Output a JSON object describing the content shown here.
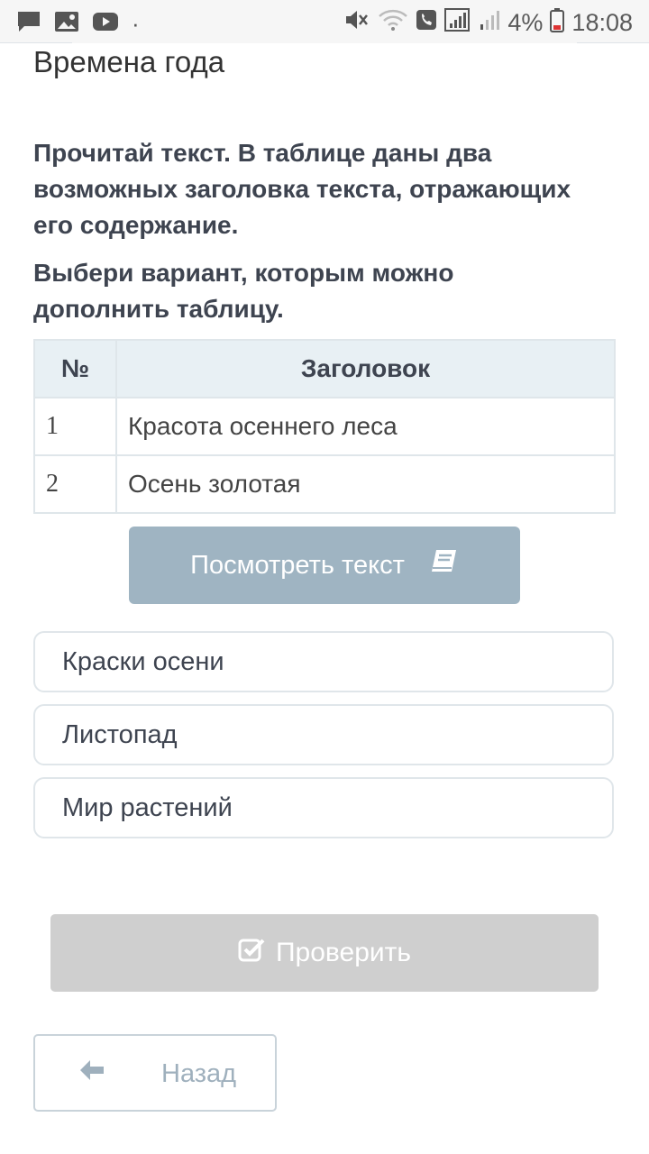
{
  "status_bar": {
    "battery_percent": "4%",
    "time": "18:08",
    "dot": "·",
    "icons": [
      "message-icon",
      "image-icon",
      "youtube-icon",
      "mute-icon",
      "wifi-icon",
      "phone-icon",
      "signal-icon",
      "signal-weak-icon",
      "battery-low-icon"
    ]
  },
  "page": {
    "title": "Времена года"
  },
  "instructions": {
    "line1": "Прочитай текст. В таблице даны два возможных заголовка текста, отражающих его содержание.",
    "line2": "Выбери вариант, которым можно дополнить таблицу."
  },
  "table": {
    "headers": [
      "№",
      "Заголовок"
    ],
    "rows": [
      {
        "num": "1",
        "title": "Красота осеннего леса"
      },
      {
        "num": "2",
        "title": "Осень золотая"
      }
    ]
  },
  "view_text_button": {
    "label": "Посмотреть текст",
    "icon": "book-icon"
  },
  "options": [
    {
      "label": "Краски осени"
    },
    {
      "label": "Листопад"
    },
    {
      "label": "Мир растений"
    }
  ],
  "check_button": {
    "label": "Проверить",
    "icon": "check-square-icon"
  },
  "back_button": {
    "label": "Назад",
    "icon": "arrow-left-icon"
  },
  "colors": {
    "primary_button": "#9fb4c2",
    "disabled_button": "#cfcfcf",
    "table_header_bg": "#e8f0f4",
    "text": "#3e4450"
  }
}
